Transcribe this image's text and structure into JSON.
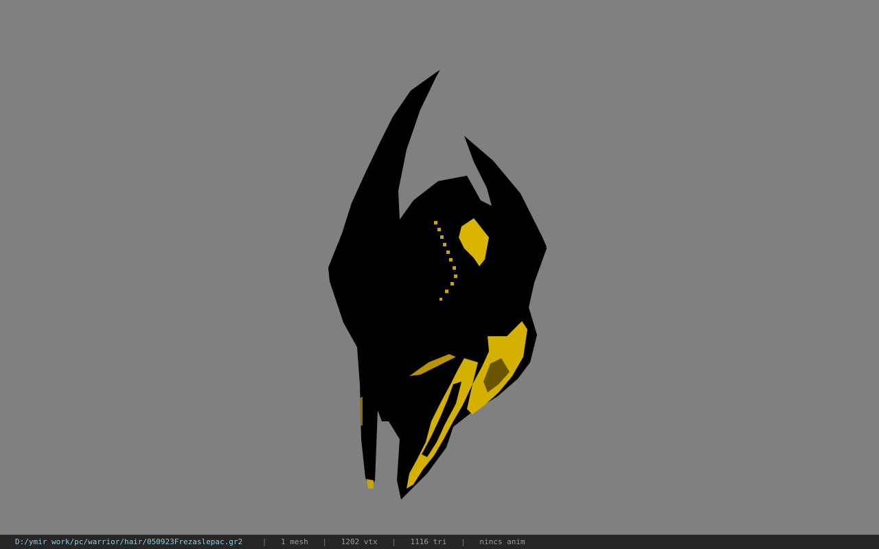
{
  "viewport": {
    "background_color": "#808080",
    "model_colors": {
      "shell": "#000000",
      "accent": "#d9b400",
      "accent_dark": "#8a7000"
    }
  },
  "status_bar": {
    "file_path": "D:/ymir work/pc/warrior/hair/050923Frezaslepac.gr2",
    "separator": "|",
    "mesh_count": "1 mesh",
    "vertex_count": "1202 vtx",
    "triangle_count": "1116 tri",
    "animation": "nincs anim"
  }
}
